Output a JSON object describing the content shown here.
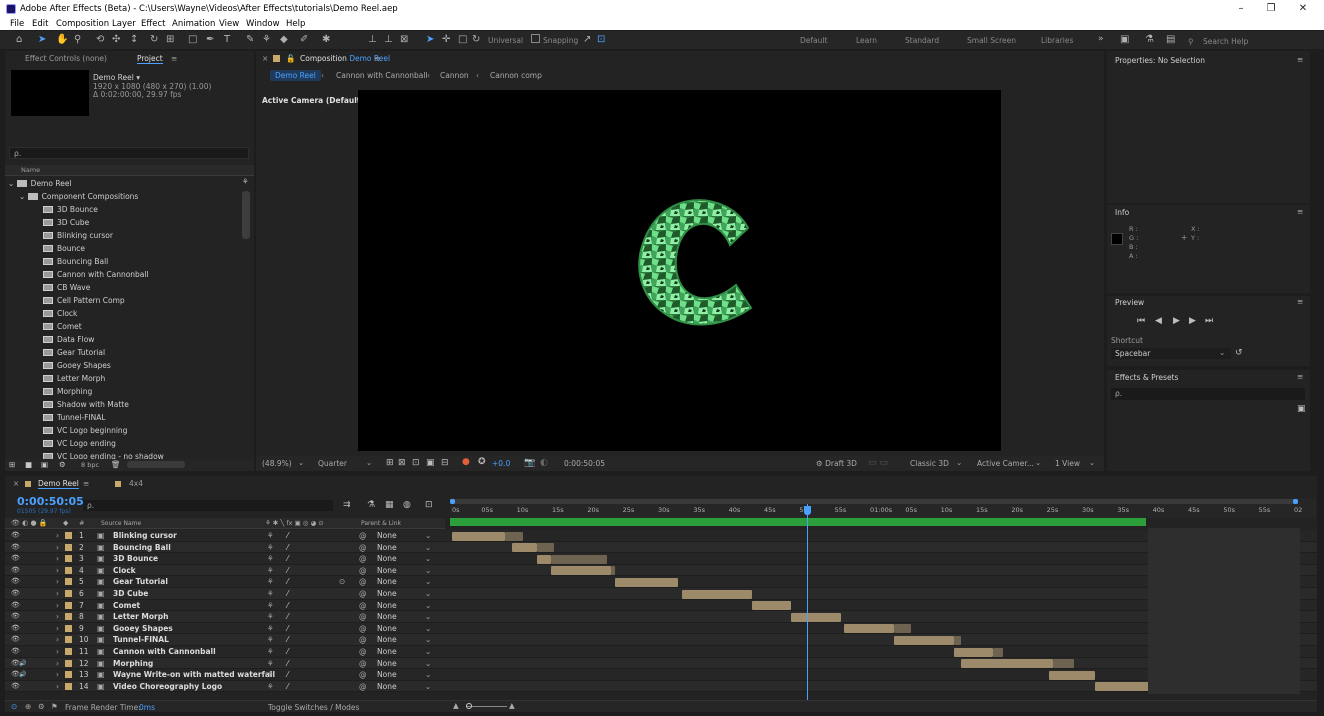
{
  "window": {
    "title": "Adobe After Effects (Beta) - C:\\Users\\Wayne\\Videos\\After Effects\\tutorials\\Demo Reel.aep",
    "min": "–",
    "restore": "❐",
    "close": "✕"
  },
  "menu": [
    "File",
    "Edit",
    "Composition",
    "Layer",
    "Effect",
    "Animation",
    "View",
    "Window",
    "Help"
  ],
  "toolbar": {
    "universal": "Universal",
    "snapping": "Snapping",
    "search_placeholder": "Search Help"
  },
  "workspaces": [
    "Default",
    "Learn",
    "Standard",
    "Small Screen",
    "Libraries"
  ],
  "project_panel": {
    "tab_effect_controls": "Effect Controls (none)",
    "tab_project": "Project",
    "selected_name": "Demo Reel ▾",
    "selected_dims": "1920 x 1080  (480 x 270) (1.00)",
    "selected_duration": "Δ 0:02:00:00, 29.97 fps",
    "search_placeholder": "ρ.",
    "col_name": "Name",
    "root": "Demo Reel",
    "folder": "Component Compositions",
    "items": [
      "3D Bounce",
      "3D Cube",
      "Blinking cursor",
      "Bounce",
      "Bouncing Ball",
      "Cannon with Cannonball",
      "CB Wave",
      "Cell Pattern Comp",
      "Clock",
      "Comet",
      "Data Flow",
      "Gear Tutorial",
      "Gooey Shapes",
      "Letter Morph",
      "Morphing",
      "Shadow with Matte",
      "Tunnel-FINAL",
      "VC Logo beginning",
      "VC Logo ending",
      "VC Logo ending - no shadow"
    ],
    "bpc": "8 bpc"
  },
  "comp_panel": {
    "tab_label": "Composition",
    "tab_comp": "Demo Reel",
    "breadcrumbs": [
      "Demo Reel",
      "Cannon with Cannonball",
      "Cannon",
      "Cannon comp"
    ],
    "camera": "Active Camera (Default)",
    "zoom": "(48.9%)",
    "resolution": "Quarter",
    "exposure": "+0.0",
    "timecode": "0:00:50:05",
    "draft": "Draft 3D",
    "renderer": "Classic 3D",
    "view_camera": "Active Camer...",
    "view_layout": "1 View"
  },
  "right_panels": {
    "properties": "Properties: No Selection",
    "info": "Info",
    "info_rgb": "R :\nG :\nB :\nA :",
    "info_xy": "X :\nY :",
    "preview": "Preview",
    "shortcut_label": "Shortcut",
    "shortcut": "Spacebar",
    "effects": "Effects & Presets"
  },
  "timeline": {
    "tab": "Demo Reel",
    "tab2": "4x4",
    "timecode": "0:00:50:05",
    "fps_line": "01505 (29.97 fps)",
    "col_source": "Source Name",
    "col_parent": "Parent & Link",
    "ruler": [
      "0s",
      "05s",
      "10s",
      "15s",
      "20s",
      "25s",
      "30s",
      "35s",
      "40s",
      "45s",
      "50s",
      "55s",
      "01:00s",
      "05s",
      "10s",
      "15s",
      "20s",
      "25s",
      "30s",
      "35s",
      "40s",
      "45s",
      "50s",
      "55s",
      "02"
    ],
    "layers": [
      {
        "n": "1",
        "name": "Blinking cursor",
        "parent": "None",
        "start": 0,
        "end": 7.5,
        "out": 10
      },
      {
        "n": "2",
        "name": "Bouncing Ball",
        "parent": "None",
        "start": 8.5,
        "end": 12,
        "out": 14.5
      },
      {
        "n": "3",
        "name": "3D Bounce",
        "parent": "None",
        "start": 12,
        "end": 14,
        "out": 22
      },
      {
        "n": "4",
        "name": "Clock",
        "parent": "None",
        "start": 14,
        "end": 22.5,
        "out": 23
      },
      {
        "n": "5",
        "name": "Gear Tutorial",
        "parent": "None",
        "start": 23,
        "end": 32,
        "out": 32
      },
      {
        "n": "6",
        "name": "3D Cube",
        "parent": "None",
        "start": 32.5,
        "end": 42.5,
        "out": 42.5
      },
      {
        "n": "7",
        "name": "Comet",
        "parent": "None",
        "start": 42.5,
        "end": 48,
        "out": 48
      },
      {
        "n": "8",
        "name": "Letter Morph",
        "parent": "None",
        "start": 48,
        "end": 55,
        "out": 55
      },
      {
        "n": "9",
        "name": "Gooey Shapes",
        "parent": "None",
        "start": 55.5,
        "end": 62.5,
        "out": 65
      },
      {
        "n": "10",
        "name": "Tunnel-FINAL",
        "parent": "None",
        "start": 62.5,
        "end": 71,
        "out": 72
      },
      {
        "n": "11",
        "name": "Cannon with Cannonball",
        "parent": "None",
        "start": 71,
        "end": 76.5,
        "out": 78
      },
      {
        "n": "12",
        "name": "Morphing",
        "parent": "None",
        "start": 72,
        "end": 85,
        "out": 88
      },
      {
        "n": "13",
        "name": "Wayne Write-on with matted waterfall",
        "parent": "None",
        "start": 84.5,
        "end": 91,
        "out": 91
      },
      {
        "n": "14",
        "name": "Video Choreography Logo",
        "parent": "None",
        "start": 91,
        "end": 99,
        "out": 99
      }
    ],
    "playhead_s": 50.2,
    "work_end_s": 98.5,
    "duration_s": 120,
    "frame_render": "Frame Render Time:",
    "frame_render_val": "0ms",
    "toggle": "Toggle Switches / Modes"
  }
}
